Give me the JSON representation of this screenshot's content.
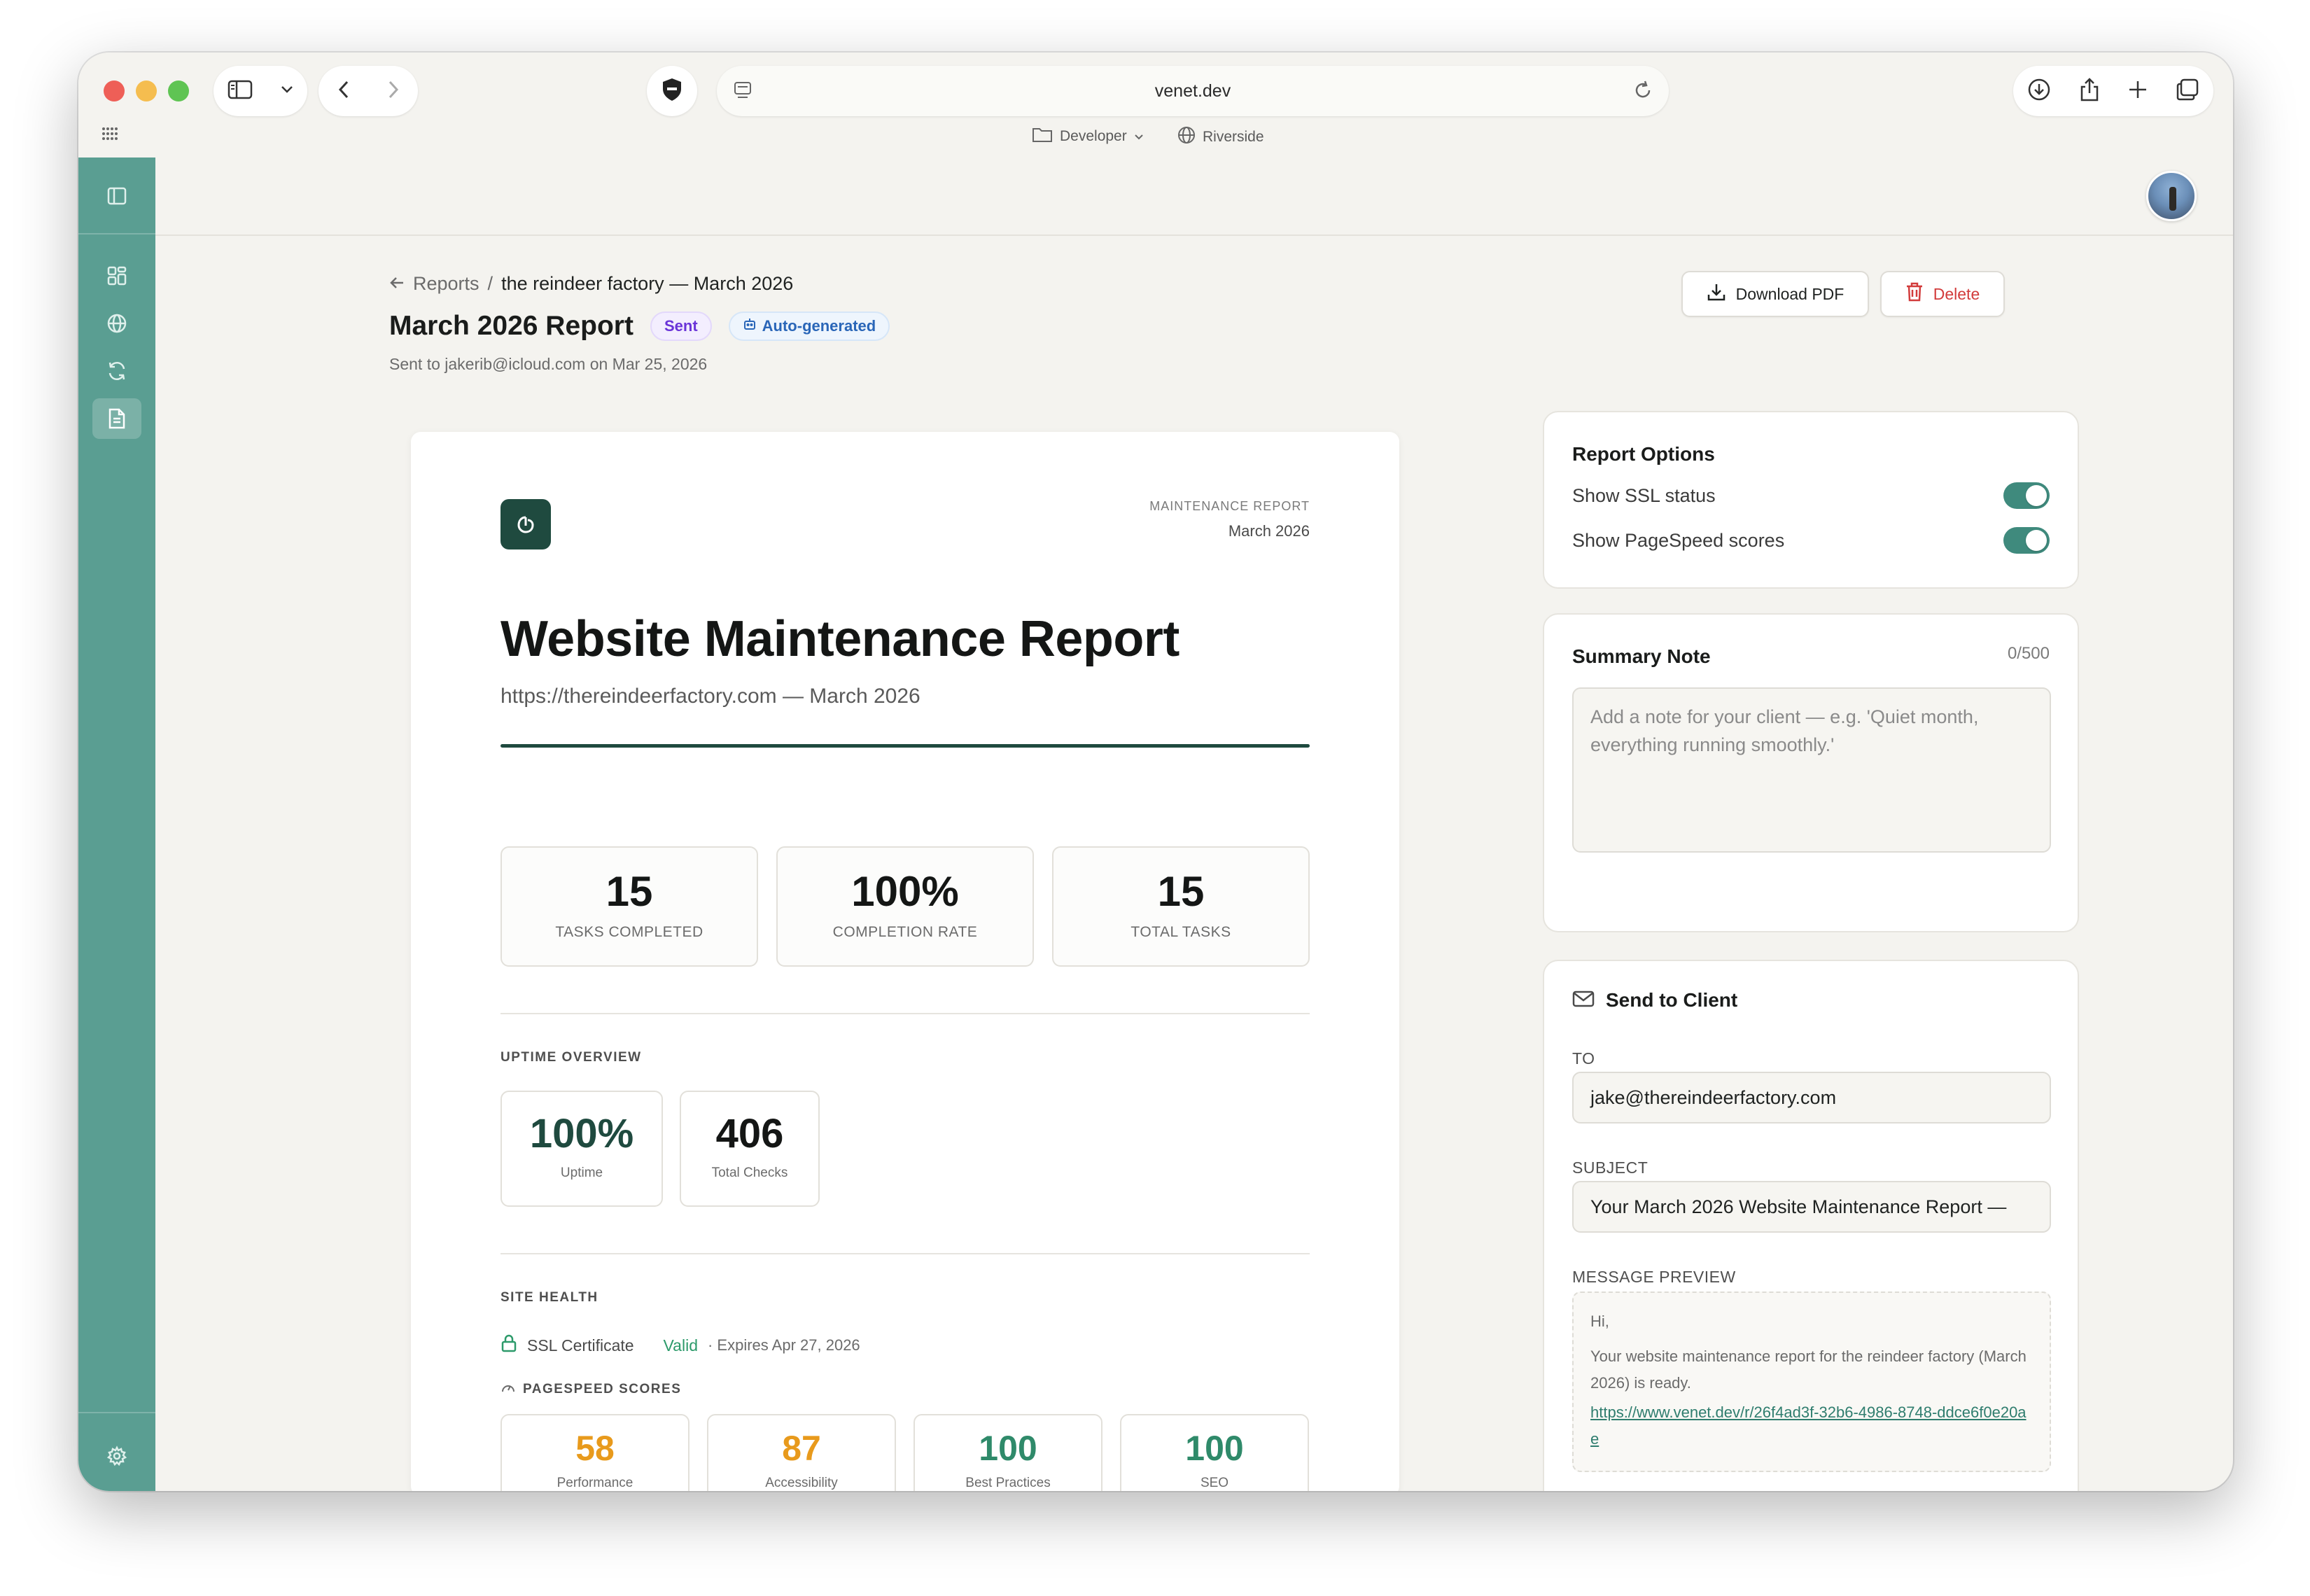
{
  "browser": {
    "url": "venet.dev",
    "favorites": [
      {
        "label": "Developer",
        "icon": "folder-icon"
      },
      {
        "label": "Riverside",
        "icon": "globe-icon"
      }
    ]
  },
  "breadcrumb": {
    "parent": "Reports",
    "separator": "/",
    "current": "the reindeer factory — March 2026"
  },
  "header": {
    "title": "March 2026 Report",
    "badge_sent": "Sent",
    "badge_auto": "Auto-generated",
    "sent_to": "Sent to jakerib@icloud.com on Mar 25, 2026",
    "download_label": "Download PDF",
    "delete_label": "Delete"
  },
  "report": {
    "label": "MAINTENANCE REPORT",
    "date": "March 2026",
    "title": "Website Maintenance Report",
    "subtitle": "https://thereindeerfactory.com — March 2026",
    "stats": [
      {
        "value": "15",
        "caption": "TASKS COMPLETED"
      },
      {
        "value": "100%",
        "caption": "COMPLETION RATE"
      },
      {
        "value": "15",
        "caption": "TOTAL TASKS"
      }
    ],
    "uptime_label": "UPTIME OVERVIEW",
    "uptime": [
      {
        "value": "100%",
        "caption": "Uptime",
        "color": "#1f4a3f"
      },
      {
        "value": "406",
        "caption": "Total Checks",
        "color": "#141615"
      }
    ],
    "site_health_label": "SITE HEALTH",
    "ssl": {
      "label": "SSL Certificate",
      "status": "Valid",
      "expires": "· Expires Apr 27, 2026"
    },
    "pagespeed_label": "PAGESPEED SCORES",
    "pagespeed": [
      {
        "value": "58",
        "caption": "Performance",
        "color": "#e89a1c"
      },
      {
        "value": "87",
        "caption": "Accessibility",
        "color": "#e89a1c"
      },
      {
        "value": "100",
        "caption": "Best Practices",
        "color": "#2f8a6a"
      },
      {
        "value": "100",
        "caption": "SEO",
        "color": "#2f8a6a"
      }
    ]
  },
  "options": {
    "title": "Report Options",
    "items": [
      {
        "label": "Show SSL status",
        "on": true
      },
      {
        "label": "Show PageSpeed scores",
        "on": true
      }
    ]
  },
  "summary": {
    "title": "Summary Note",
    "counter": "0/500",
    "placeholder": "Add a note for your client — e.g. 'Quiet month, everything running smoothly.'"
  },
  "send": {
    "title": "Send to Client",
    "to_label": "TO",
    "to_value": "jake@thereindeerfactory.com",
    "subject_label": "SUBJECT",
    "subject_value": "Your March 2026 Website Maintenance Report —",
    "preview_label": "MESSAGE PREVIEW",
    "preview_greeting": "Hi,",
    "preview_body": "Your website maintenance report for the reindeer factory (March 2026) is ready.",
    "preview_link": "https://www.venet.dev/r/26f4ad3f-32b6-4986-8748-ddce6f0e20ae"
  },
  "colors": {
    "sidebar": "#5a9e92",
    "accent": "#1f4a3f",
    "toggle_on": "#3f8a7d",
    "delete": "#d23b3b"
  }
}
